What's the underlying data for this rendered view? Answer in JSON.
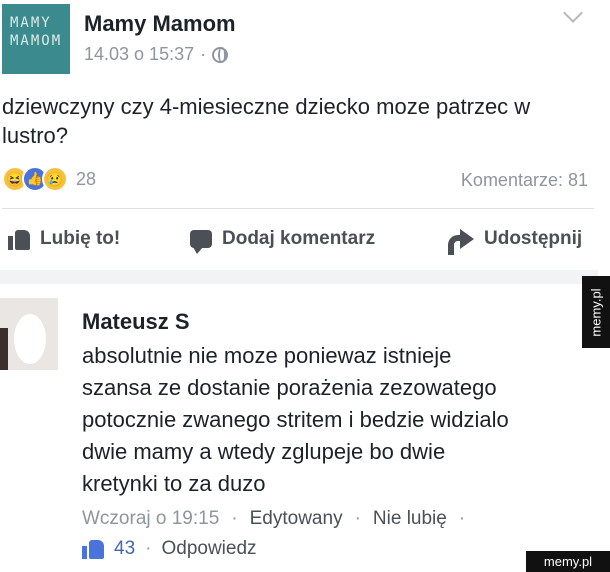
{
  "post": {
    "logo_line1": "MAMY",
    "logo_line2": "MAMOM",
    "page_name": "Mamy Mamom",
    "timestamp": "14.03 o 15:37",
    "separator": "·",
    "text": "dziewczyny czy 4-miesieczne dziecko moze patrzec w lustro?",
    "reaction_count": "28",
    "comments_label": "Komentarze: 81"
  },
  "actions": {
    "like": "Lubię to!",
    "comment": "Dodaj komentarz",
    "share": "Udostępnij"
  },
  "comment": {
    "author": "Mateusz S",
    "text": "absolutnie nie moze poniewaz istnieje szansa ze dostanie porażenia zezowatego potocznie zwanego stritem i bedzie widzialo dwie mamy a wtedy zglupeje bo dwie kretynki to za duzo",
    "time": "Wczoraj o 19:15",
    "edited": "Edytowany",
    "unlike": "Nie lubię",
    "sep": "·",
    "like_count": "43",
    "reply": "Odpowiedz"
  },
  "watermarks": {
    "side": "memy.pl",
    "bottom": "memy.pl"
  }
}
